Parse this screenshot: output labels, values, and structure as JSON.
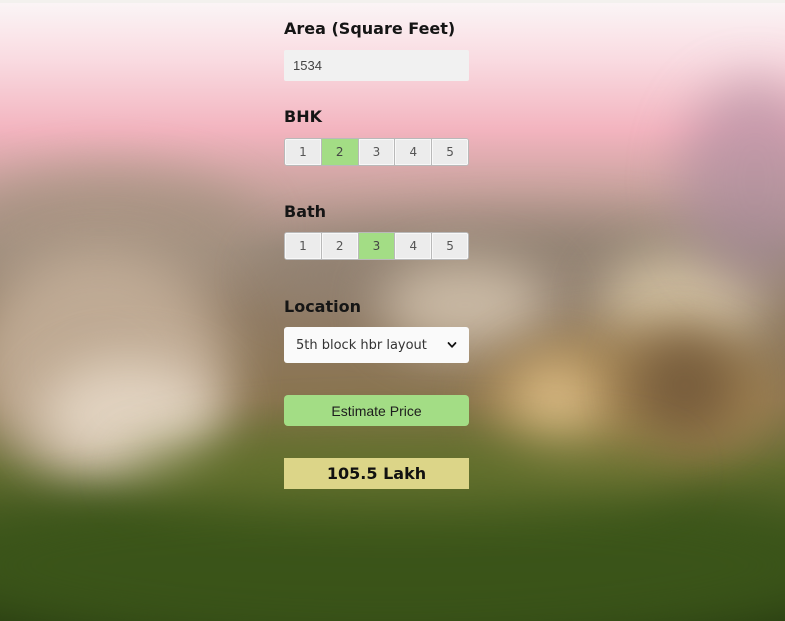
{
  "area": {
    "label": "Area (Square Feet)",
    "value": "1534"
  },
  "bhk": {
    "label": "BHK",
    "options": [
      "1",
      "2",
      "3",
      "4",
      "5"
    ],
    "selected": "2"
  },
  "bath": {
    "label": "Bath",
    "options": [
      "1",
      "2",
      "3",
      "4",
      "5"
    ],
    "selected": "3"
  },
  "location": {
    "label": "Location",
    "selected": "5th block hbr layout"
  },
  "estimate": {
    "button_label": "Estimate Price"
  },
  "result": {
    "text": "105.5 Lakh"
  },
  "colors": {
    "accent_green": "#a3dd85",
    "result_bg": "#dcd588"
  },
  "icons": {
    "dropdown": "chevron-down-icon"
  }
}
